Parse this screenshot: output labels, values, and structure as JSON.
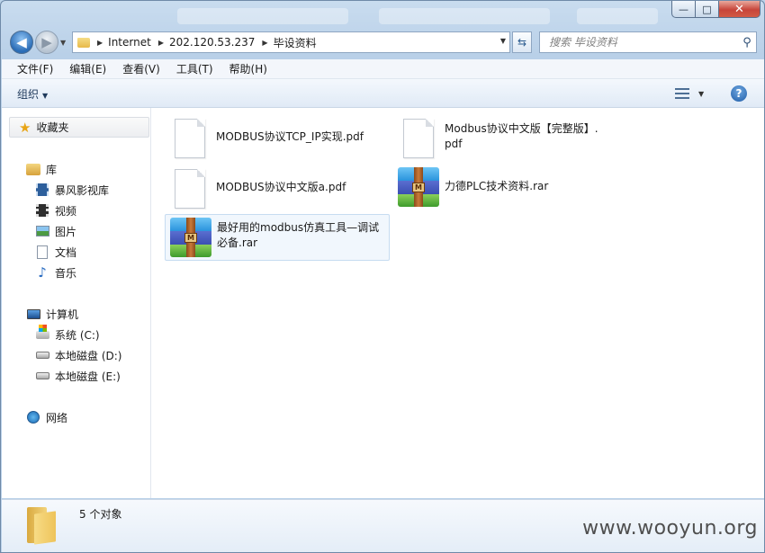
{
  "window": {
    "buttons": {
      "minimize": "—",
      "maximize": "□",
      "close": "✕"
    }
  },
  "address": {
    "crumbs": [
      "Internet",
      "202.120.53.237",
      "毕设资料"
    ]
  },
  "search": {
    "placeholder": "搜索 毕设资料"
  },
  "menu": [
    "文件(F)",
    "编辑(E)",
    "查看(V)",
    "工具(T)",
    "帮助(H)"
  ],
  "toolbar": {
    "organize": "组织"
  },
  "sidebar": {
    "favorites": "收藏夹",
    "libraries": {
      "label": "库",
      "items": [
        "暴风影视库",
        "视频",
        "图片",
        "文档",
        "音乐"
      ]
    },
    "computer": {
      "label": "计算机",
      "items": [
        "系统 (C:)",
        "本地磁盘 (D:)",
        "本地磁盘 (E:)"
      ]
    },
    "network": "网络"
  },
  "files": [
    {
      "name": "MODBUS协议TCP_IP实现.pdf",
      "type": "pdf"
    },
    {
      "name": "Modbus协议中文版【完整版】.pdf",
      "type": "pdf"
    },
    {
      "name": "MODBUS协议中文版a.pdf",
      "type": "pdf"
    },
    {
      "name": "力德PLC技术资料.rar",
      "type": "rar"
    },
    {
      "name": "最好用的modbus仿真工具—调试必备.rar",
      "type": "rar"
    }
  ],
  "status": {
    "count": "5 个对象"
  },
  "watermark": "www.wooyun.org",
  "colors": {
    "accent": "#2a6cb6",
    "selection": "#f1f7fd"
  }
}
